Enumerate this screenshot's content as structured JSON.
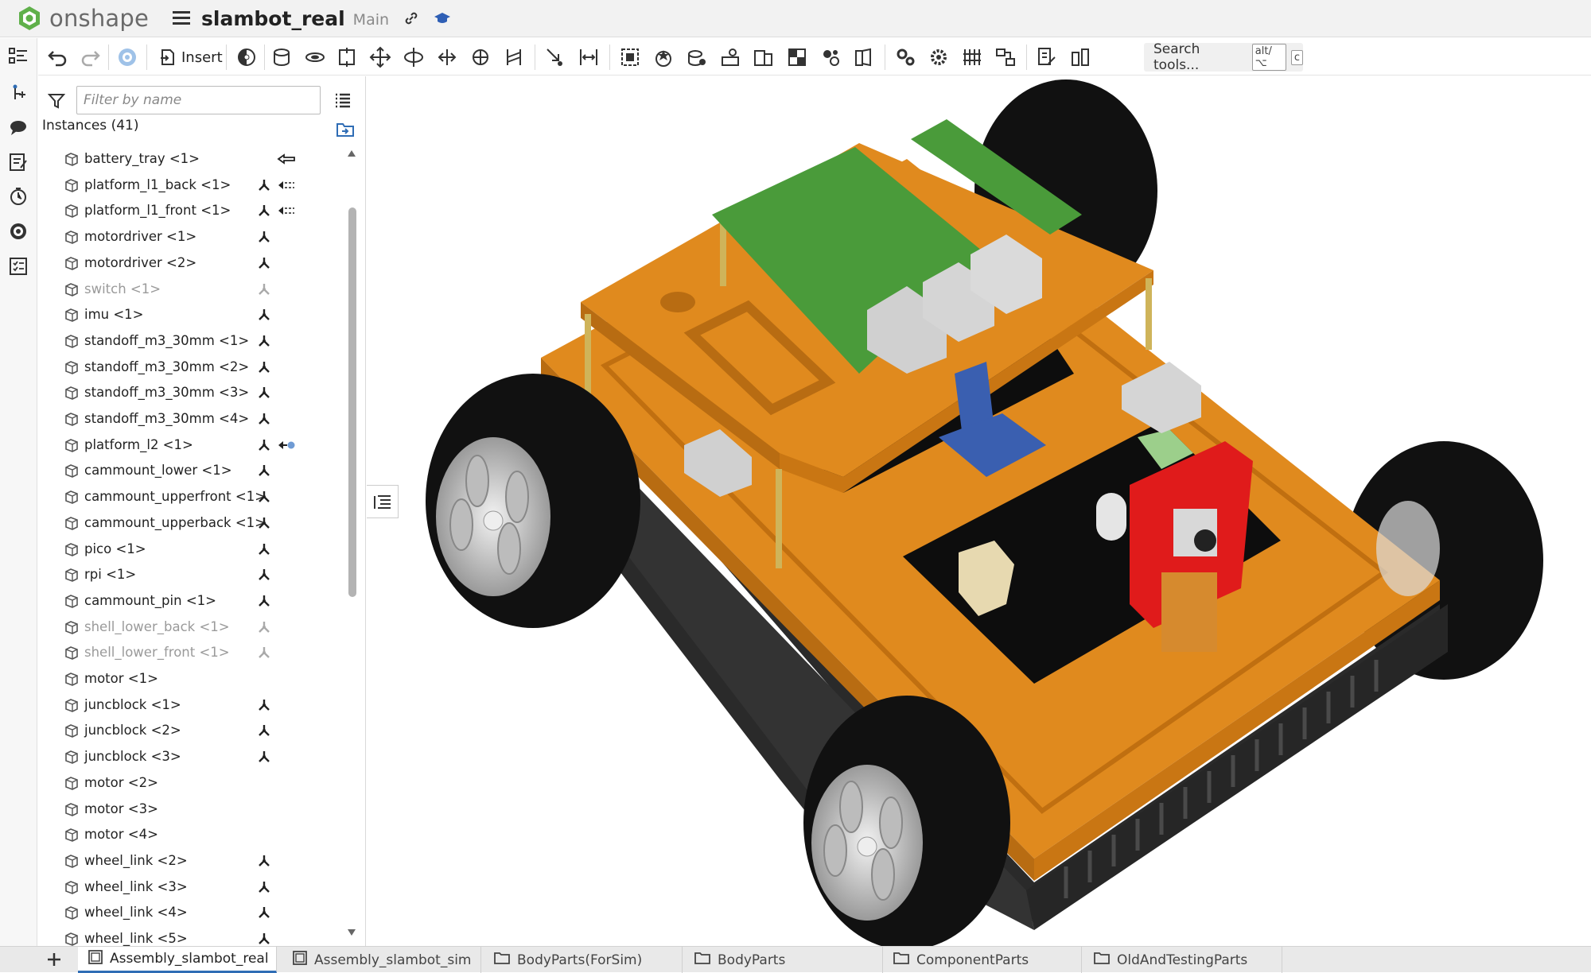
{
  "header": {
    "app_name": "onshape",
    "doc_title": "slambot_real",
    "workspace": "Main"
  },
  "toolbar": {
    "insert_label": "Insert",
    "search_label": "Search tools...",
    "shortcut_mod": "alt/⌥",
    "shortcut_key": "c"
  },
  "instances_panel": {
    "filter_placeholder": "Filter by name",
    "heading": "Instances (41)",
    "items": [
      {
        "label": "battery_tray <1>",
        "mate": false,
        "extra": "arrow"
      },
      {
        "label": "platform_l1_back <1>",
        "mate": true,
        "extra": "dashed-arrow"
      },
      {
        "label": "platform_l1_front <1>",
        "mate": true,
        "extra": "dashed-arrow"
      },
      {
        "label": "motordriver <1>",
        "mate": true,
        "extra": ""
      },
      {
        "label": "motordriver <2>",
        "mate": true,
        "extra": ""
      },
      {
        "label": "switch <1>",
        "mate": true,
        "extra": "",
        "dim": true
      },
      {
        "label": "imu <1>",
        "mate": true,
        "extra": ""
      },
      {
        "label": "standoff_m3_30mm <1>",
        "mate": true,
        "extra": ""
      },
      {
        "label": "standoff_m3_30mm <2>",
        "mate": true,
        "extra": ""
      },
      {
        "label": "standoff_m3_30mm <3>",
        "mate": true,
        "extra": ""
      },
      {
        "label": "standoff_m3_30mm <4>",
        "mate": true,
        "extra": ""
      },
      {
        "label": "platform_l2 <1>",
        "mate": true,
        "extra": "dot-arrow"
      },
      {
        "label": "cammount_lower <1>",
        "mate": true,
        "extra": ""
      },
      {
        "label": "cammount_upperfront <1>",
        "mate": true,
        "extra": ""
      },
      {
        "label": "cammount_upperback <1>",
        "mate": true,
        "extra": ""
      },
      {
        "label": "pico <1>",
        "mate": true,
        "extra": ""
      },
      {
        "label": "rpi <1>",
        "mate": true,
        "extra": ""
      },
      {
        "label": "cammount_pin <1>",
        "mate": true,
        "extra": ""
      },
      {
        "label": "shell_lower_back <1>",
        "mate": true,
        "extra": "",
        "dim": true
      },
      {
        "label": "shell_lower_front <1>",
        "mate": true,
        "extra": "",
        "dim": true
      },
      {
        "label": "motor <1>",
        "mate": false,
        "extra": ""
      },
      {
        "label": "juncblock <1>",
        "mate": true,
        "extra": ""
      },
      {
        "label": "juncblock <2>",
        "mate": true,
        "extra": ""
      },
      {
        "label": "juncblock <3>",
        "mate": true,
        "extra": ""
      },
      {
        "label": "motor <2>",
        "mate": false,
        "extra": ""
      },
      {
        "label": "motor <3>",
        "mate": false,
        "extra": ""
      },
      {
        "label": "motor <4>",
        "mate": false,
        "extra": ""
      },
      {
        "label": "wheel_link <2>",
        "mate": true,
        "extra": ""
      },
      {
        "label": "wheel_link <3>",
        "mate": true,
        "extra": ""
      },
      {
        "label": "wheel_link <4>",
        "mate": true,
        "extra": ""
      },
      {
        "label": "wheel_link <5>",
        "mate": true,
        "extra": ""
      }
    ]
  },
  "tabs": [
    {
      "label": "Assembly_slambot_real",
      "type": "assembly",
      "active": true
    },
    {
      "label": "Assembly_slambot_sim",
      "type": "assembly",
      "active": false
    },
    {
      "label": "BodyParts(ForSim)",
      "type": "folder",
      "active": false
    },
    {
      "label": "BodyParts",
      "type": "folder",
      "active": false
    },
    {
      "label": "ComponentParts",
      "type": "folder",
      "active": false
    },
    {
      "label": "OldAndTestingParts",
      "type": "folder",
      "active": false
    }
  ],
  "colors": {
    "accent": "#2f6db5",
    "logo_green": "#5fb04a",
    "orange": "#e08a1e",
    "pcb_green": "#4a9b3a"
  }
}
